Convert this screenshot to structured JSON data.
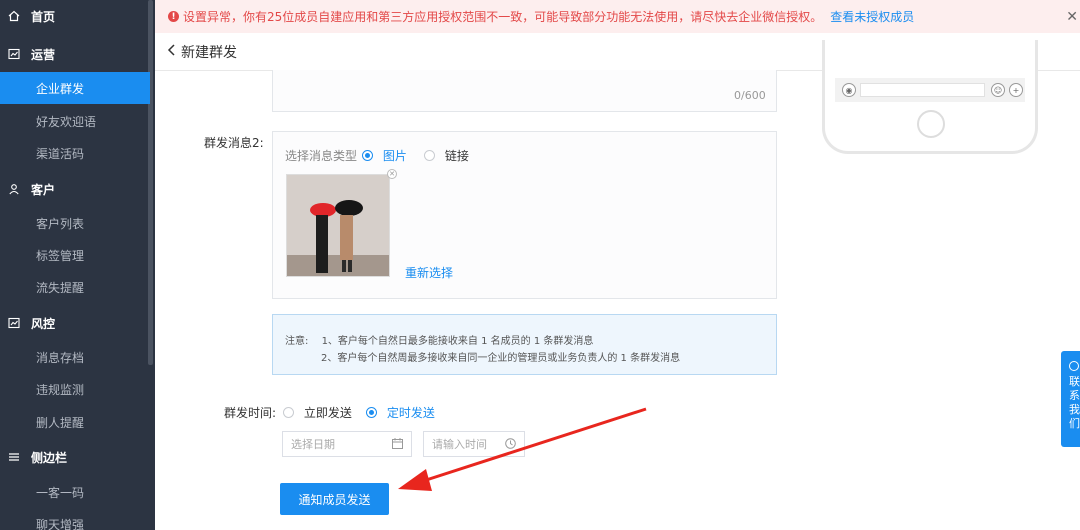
{
  "sidebar": {
    "home": "首页",
    "groups": [
      {
        "label": "运营",
        "items": [
          "企业群发",
          "好友欢迎语",
          "渠道活码"
        ]
      },
      {
        "label": "客户",
        "items": [
          "客户列表",
          "标签管理",
          "流失提醒"
        ]
      },
      {
        "label": "风控",
        "items": [
          "消息存档",
          "违规监测",
          "删人提醒"
        ]
      },
      {
        "label": "侧边栏",
        "items": [
          "一客一码",
          "聊天增强"
        ]
      }
    ],
    "active": "企业群发"
  },
  "alert": {
    "text": "设置异常，你有25位成员自建应用和第三方应用授权范围不一致，可能导致部分功能无法使用，请尽快去企业微信授权。",
    "link": "查看未授权成员"
  },
  "header": {
    "title": "新建群发"
  },
  "form": {
    "counter": "0/600",
    "msg2_label": "群发消息2:",
    "msg_type_label": "选择消息类型",
    "type_image": "图片",
    "type_link": "链接",
    "reselect": "重新选择",
    "notice_prefix": "注意:",
    "notice_1": "1、客户每个自然日最多能接收来自 1 名成员的 1 条群发消息",
    "notice_2": "2、客户每个自然周最多接收来自同一企业的管理员或业务负责人的 1 条群发消息",
    "send_time_label": "群发时间:",
    "send_now": "立即发送",
    "send_scheduled": "定时发送",
    "date_placeholder": "选择日期",
    "time_placeholder": "请输入时间",
    "submit": "通知成员发送"
  },
  "float_tab": {
    "text": [
      "联",
      "系",
      "我",
      "们"
    ]
  },
  "colors": {
    "accent": "#1a8df0",
    "sidebar_bg": "#2c3442",
    "alert_red": "#e34848",
    "arrow_red": "#e8261e"
  }
}
